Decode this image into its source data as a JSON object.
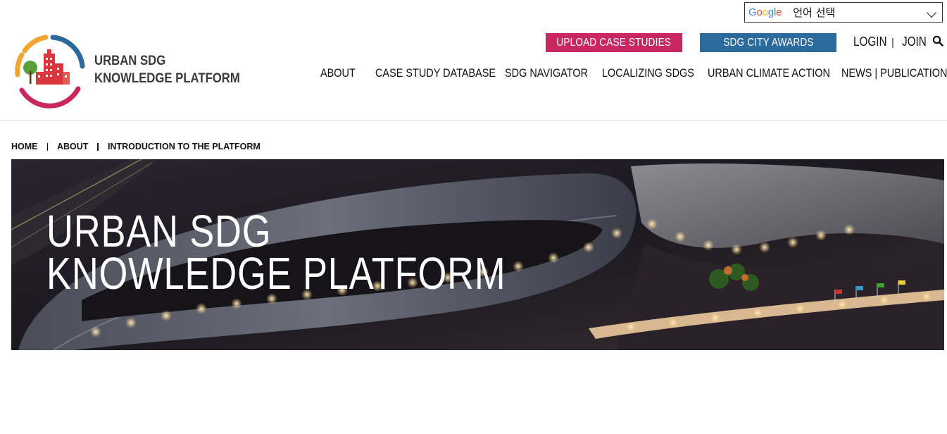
{
  "translate": {
    "brand": "Google",
    "label": "언어 선택"
  },
  "logo": {
    "line1": "URBAN SDG",
    "line2": "KNOWLEDGE PLATFORM",
    "colors": {
      "orange": "#f0a530",
      "blue": "#2b6a9c",
      "pink": "#c8285f",
      "red": "#d9363e",
      "green": "#5aa03a"
    }
  },
  "header": {
    "upload_label": "UPLOAD CASE STUDIES",
    "awards_label": "SDG CITY AWARDS",
    "login_label": "LOGIN",
    "separator": "|",
    "join_label": "JOIN"
  },
  "nav": {
    "items": [
      {
        "label": "ABOUT"
      },
      {
        "label": "CASE STUDY DATABASE"
      },
      {
        "label": "SDG NAVIGATOR"
      },
      {
        "label": "LOCALIZING SDGS"
      },
      {
        "label": "URBAN CLIMATE ACTION"
      },
      {
        "label": "NEWS | PUBLICATIONS"
      }
    ]
  },
  "breadcrumb": {
    "items": [
      {
        "label": "HOME"
      },
      {
        "label": "ABOUT"
      },
      {
        "label": "INTRODUCTION TO THE PLATFORM"
      }
    ]
  },
  "hero": {
    "line1": "URBAN SDG",
    "line2": "KNOWLEDGE PLATFORM"
  }
}
